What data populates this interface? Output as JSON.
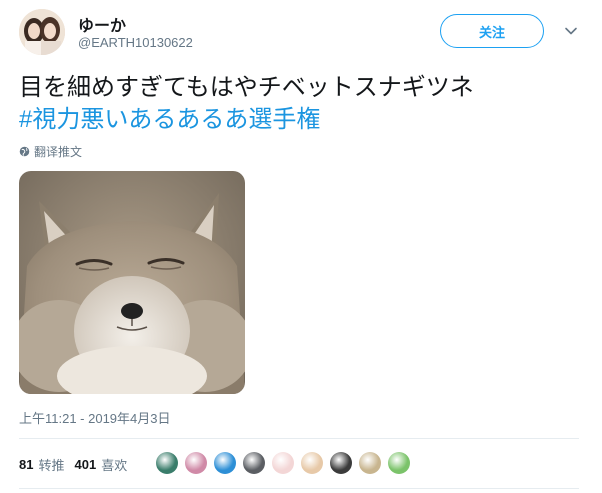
{
  "user": {
    "display_name": "ゆーか",
    "screen_name": "@EARTH10130622",
    "avatar_icon": "avatar-photo"
  },
  "follow_button": {
    "label": "关注"
  },
  "menu": {
    "icon": "chevron-down-icon"
  },
  "tweet": {
    "text_line1": "目を細めすぎてもはやチベットスナギツネ",
    "hashtag": "#視力悪いあるあるあ選手権"
  },
  "translate": {
    "label": "翻译推文",
    "icon": "globe-icon"
  },
  "photo": {
    "subject": "tibetan-fox-photo"
  },
  "timestamp": "上午11:21 - 2019年4月3日",
  "stats": {
    "retweets_count": "81",
    "retweets_label": "转推",
    "likes_count": "401",
    "likes_label": "喜欢"
  },
  "liker_avatars": [
    {
      "color": "#3a7d6b"
    },
    {
      "color": "#d08aa7"
    },
    {
      "color": "#2d8fd6"
    },
    {
      "color": "#5b5e63"
    },
    {
      "color": "#f3d6d6"
    },
    {
      "color": "#e7c9a8"
    },
    {
      "color": "#3b3b3b"
    },
    {
      "color": "#c8b58f"
    },
    {
      "color": "#7bc36a"
    }
  ],
  "colors": {
    "accent": "#1da1f2",
    "hashtag": "#1b95e0",
    "muted": "#657786",
    "text": "#14171a"
  }
}
